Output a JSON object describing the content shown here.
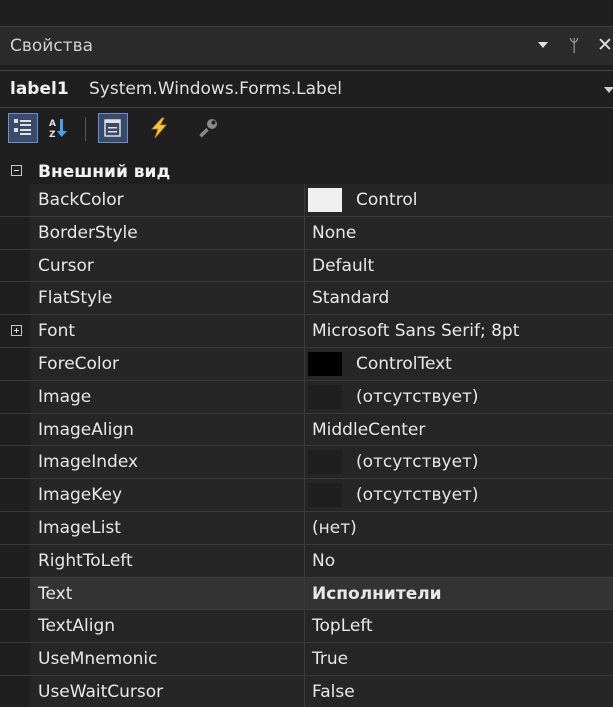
{
  "window": {
    "title": "Свойства",
    "dropdown_icon": "chevron-down-icon",
    "pin_glyph": "ᛘ",
    "close_glyph": "✕"
  },
  "object_selector": {
    "name": "label1",
    "type": "System.Windows.Forms.Label"
  },
  "toolbar": {
    "buttons": [
      {
        "name": "categorized-view-button",
        "icon": "categorized-icon",
        "active": true
      },
      {
        "name": "alphabetical-view-button",
        "icon": "alphabetical-sort-icon",
        "active": false
      },
      {
        "name": "properties-view-button",
        "icon": "properties-icon",
        "active": true
      },
      {
        "name": "events-view-button",
        "icon": "lightning-icon",
        "active": false
      },
      {
        "name": "property-pages-button",
        "icon": "wrench-icon",
        "active": false
      }
    ]
  },
  "category": {
    "label": "Внешний вид"
  },
  "properties": [
    {
      "name": "BackColor",
      "value": "Control",
      "swatch": "#f0f0f0"
    },
    {
      "name": "BorderStyle",
      "value": "None"
    },
    {
      "name": "Cursor",
      "value": "Default"
    },
    {
      "name": "FlatStyle",
      "value": "Standard"
    },
    {
      "name": "Font",
      "value": "Microsoft Sans Serif; 8pt",
      "expandable": true
    },
    {
      "name": "ForeColor",
      "value": "ControlText",
      "swatch": "#000000"
    },
    {
      "name": "Image",
      "value": "(отсутствует)",
      "swatch": "#1f1f1f"
    },
    {
      "name": "ImageAlign",
      "value": "MiddleCenter"
    },
    {
      "name": "ImageIndex",
      "value": "(отсутствует)",
      "swatch": "#1f1f1f"
    },
    {
      "name": "ImageKey",
      "value": "(отсутствует)",
      "swatch": "#1f1f1f"
    },
    {
      "name": "ImageList",
      "value": "(нет)"
    },
    {
      "name": "RightToLeft",
      "value": "No"
    },
    {
      "name": "Text",
      "value": "Исполнители",
      "bold": true,
      "selected": true
    },
    {
      "name": "TextAlign",
      "value": "TopLeft"
    },
    {
      "name": "UseMnemonic",
      "value": "True"
    },
    {
      "name": "UseWaitCursor",
      "value": "False"
    }
  ]
}
